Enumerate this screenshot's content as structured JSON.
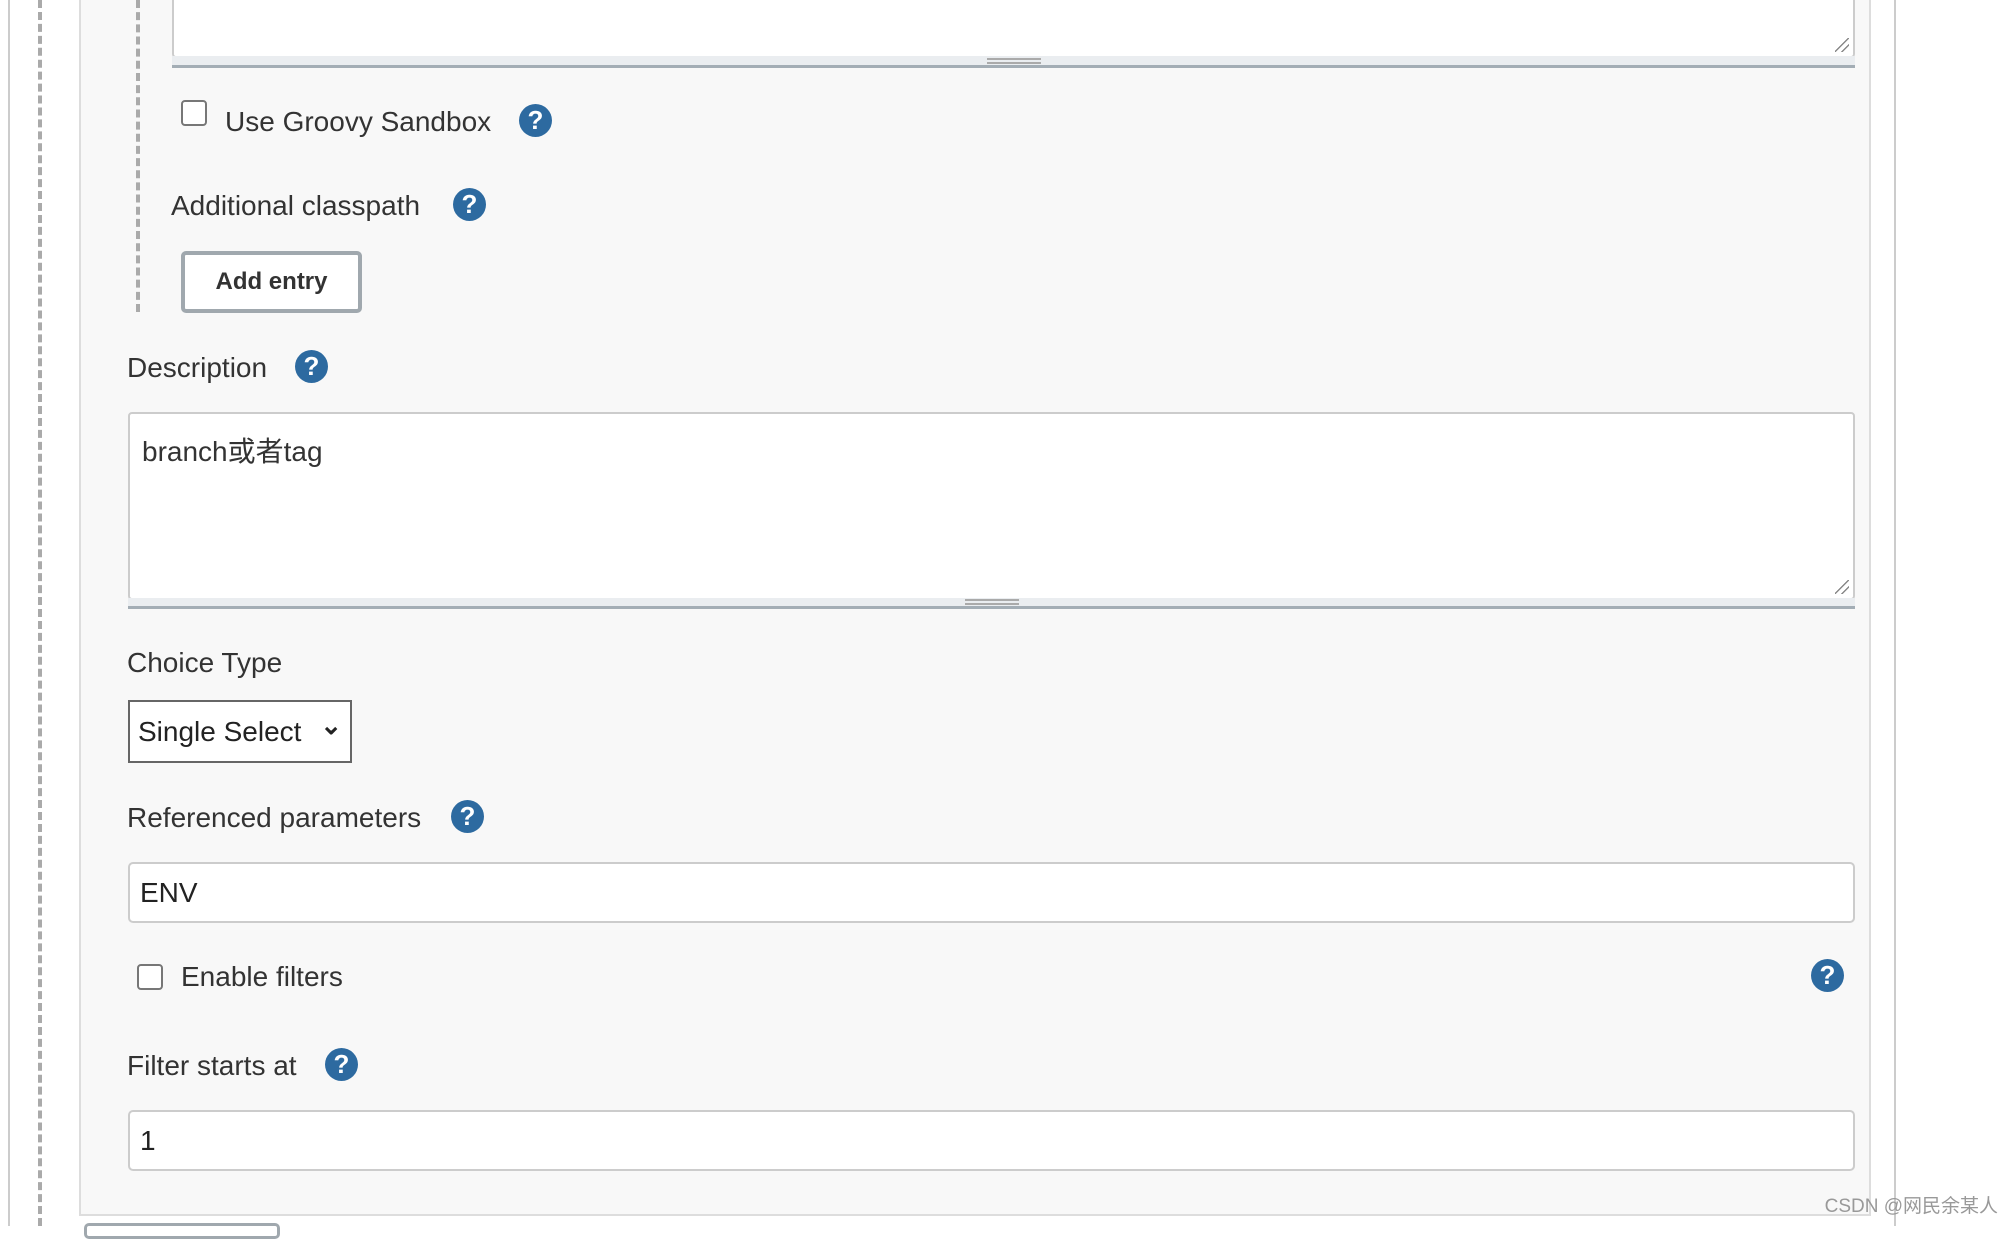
{
  "sandbox": {
    "label": "Use Groovy Sandbox",
    "checked": false
  },
  "classpath": {
    "label": "Additional classpath",
    "add_button": "Add entry"
  },
  "description": {
    "label": "Description",
    "value": "branch或者tag"
  },
  "choice_type": {
    "label": "Choice Type",
    "selected": "Single Select"
  },
  "referenced_parameters": {
    "label": "Referenced parameters",
    "value": "ENV"
  },
  "enable_filters": {
    "label": "Enable filters",
    "checked": false
  },
  "filter_starts_at": {
    "label": "Filter starts at",
    "value": "1"
  },
  "help_glyph": "?",
  "dropdown_glyph": "⌄",
  "watermark": "CSDN @网民余某人",
  "colors": {
    "help_icon": "#2d6aa0",
    "panel_bg": "#f8f8f8"
  }
}
